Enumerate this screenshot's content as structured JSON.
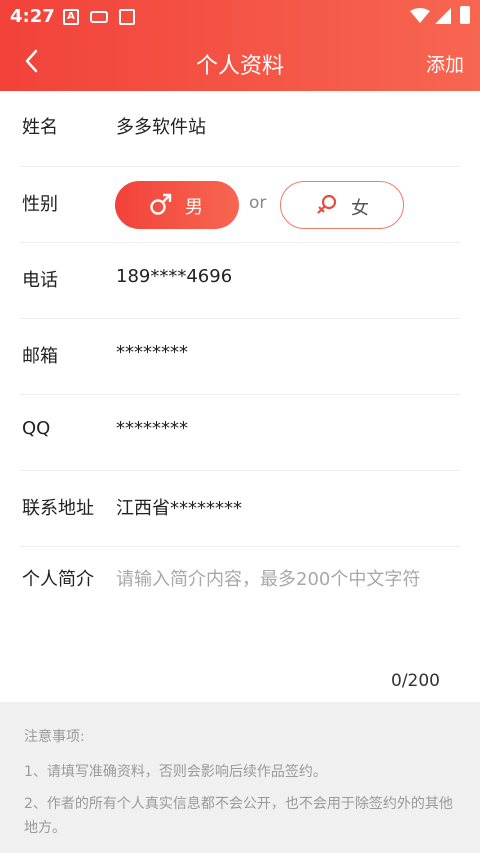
{
  "status_bar": {
    "time": "4:27",
    "icons": [
      "a-notification-icon",
      "keyboard-icon",
      "book-icon",
      "wifi-icon",
      "cellular-icon",
      "battery-icon"
    ]
  },
  "header": {
    "title": "个人资料",
    "action_label": "添加",
    "back_icon": "back-chevron-icon",
    "gradient_colors": [
      "#f2423a",
      "#f76650"
    ]
  },
  "form": {
    "name": {
      "label": "姓名",
      "value": "多多软件站"
    },
    "gender": {
      "label": "性别",
      "male_label": "男",
      "female_label": "女",
      "separator": "or",
      "selected": "男"
    },
    "phone": {
      "label": "电话",
      "value": "189****4696"
    },
    "email": {
      "label": "邮箱",
      "value": "********"
    },
    "qq": {
      "label": "QQ",
      "value": "********"
    },
    "address": {
      "label": "联系地址",
      "value": "江西省********"
    },
    "bio": {
      "label": "个人简介",
      "placeholder": "请输入简介内容，最多200个中文字符",
      "counter": "0/200"
    }
  },
  "notes": {
    "title": "注意事项:",
    "items": [
      "1、请填写准确资料，否则会影响后续作品签约。",
      "2、作者的所有个人真实信息都不会公开，也不会用于除签约外的其他地方。"
    ]
  }
}
